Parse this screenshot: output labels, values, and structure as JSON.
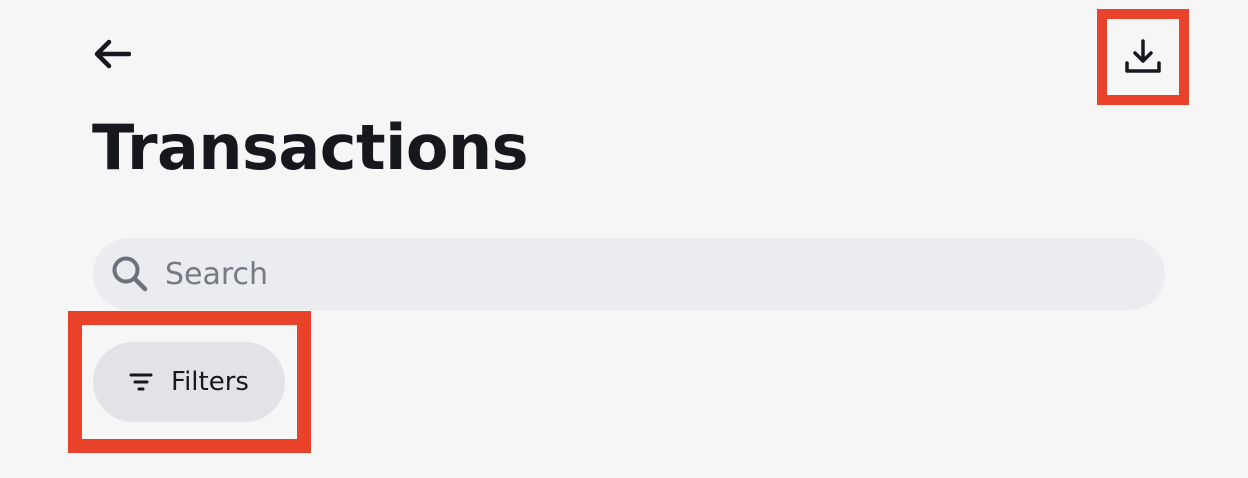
{
  "header": {
    "back_icon": "arrow-left-icon",
    "download_icon": "download-icon",
    "title": "Transactions"
  },
  "search": {
    "icon": "search-icon",
    "placeholder": "Search",
    "value": ""
  },
  "filters": {
    "icon": "filter-lines-icon",
    "label": "Filters"
  },
  "colors": {
    "background": "#f6f6f7",
    "text": "#16181d",
    "search_bg": "#ebecef",
    "filters_bg": "#e1e3e7",
    "highlight": "#e9422a",
    "placeholder": "#767a82"
  }
}
